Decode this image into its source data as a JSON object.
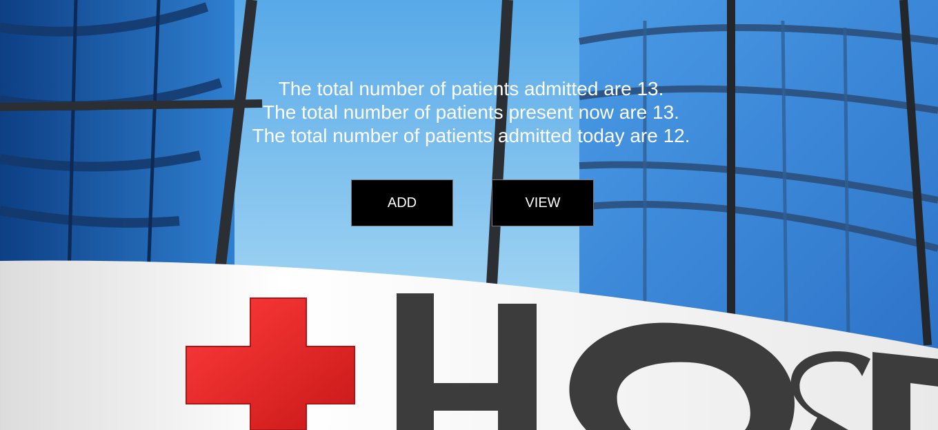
{
  "stats": {
    "line_admitted": "The total number of patients admitted are 13.",
    "line_present": "The total number of patients present now are 13.",
    "line_today": "The total number of patients admitted today are 12."
  },
  "buttons": {
    "add_label": "ADD",
    "view_label": "VIEW"
  },
  "background": {
    "sign_text": "HOSP",
    "colors": {
      "sky": "#6fb7ea",
      "glass_dark": "#1f5fae",
      "frame": "#2b2f33",
      "sign": "#f2f2f2",
      "cross": "#e02424",
      "letters": "#3c3c3c"
    }
  }
}
